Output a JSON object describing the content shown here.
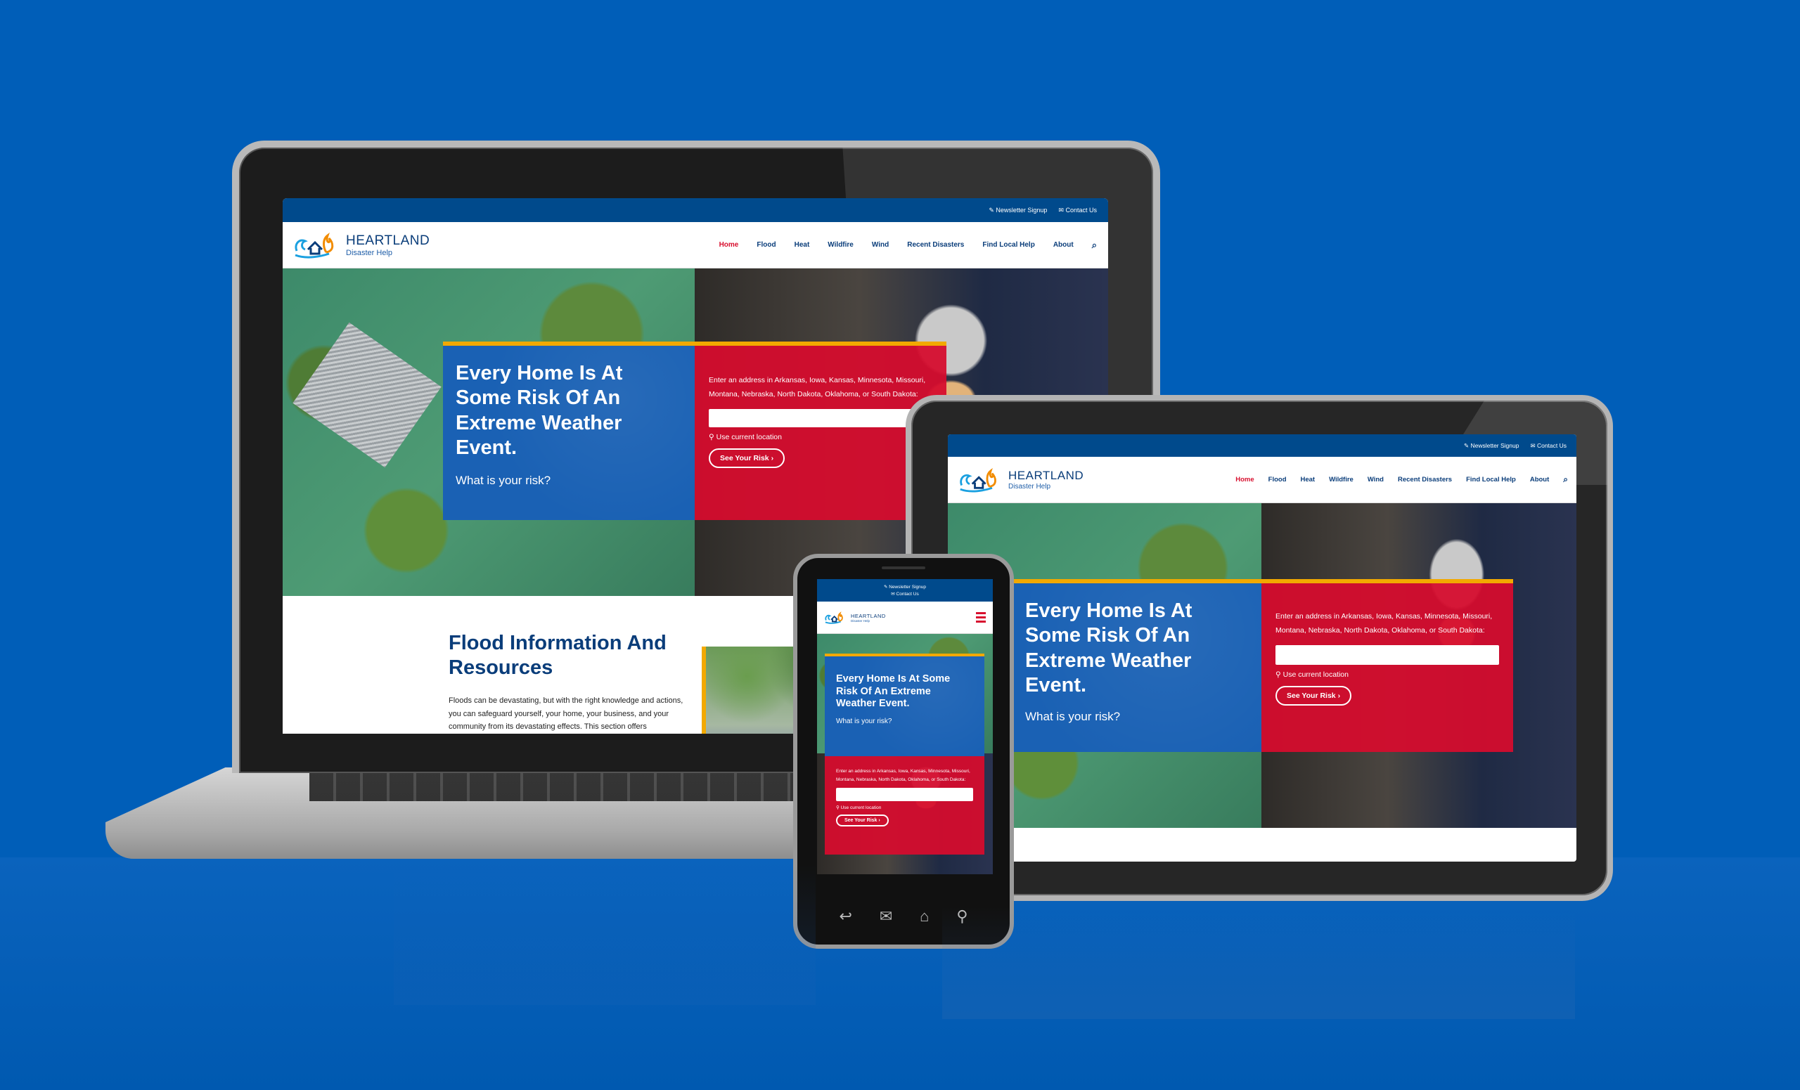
{
  "colors": {
    "background": "#005EB8",
    "topbar": "#004A8C",
    "navy_text": "#0a3d7a",
    "active_red": "#d8102f",
    "hero_blue": "#1a61b4",
    "hero_red": "#d60c2e",
    "accent_gold": "#f2a900"
  },
  "site": {
    "brand": "HEARTLAND",
    "tagline": "Disaster Help",
    "topbar": {
      "newsletter_icon": "pencil-icon",
      "newsletter": "Newsletter Signup",
      "contact_icon": "envelope-icon",
      "contact": "Contact Us"
    },
    "nav": [
      {
        "label": "Home",
        "active": true
      },
      {
        "label": "Flood",
        "active": false
      },
      {
        "label": "Heat",
        "active": false
      },
      {
        "label": "Wildfire",
        "active": false
      },
      {
        "label": "Wind",
        "active": false
      },
      {
        "label": "Recent Disasters",
        "active": false
      },
      {
        "label": "Find Local Help",
        "active": false
      },
      {
        "label": "About",
        "active": false
      }
    ],
    "search_icon": "search-icon",
    "menu_icon": "hamburger-menu-icon",
    "hero": {
      "headline": "Every Home Is At Some Risk Of An Extreme Weather Event.",
      "subhead": "What is your risk?",
      "prompt": "Enter an address in Arkansas, Iowa, Kansas, Minnesota, Missouri, Montana, Nebraska, North Dakota, Oklahoma, or South Dakota:",
      "address_value": "",
      "use_location_icon": "map-pin-icon",
      "use_location": "Use current location",
      "cta": "See Your Risk",
      "cta_icon": "›"
    },
    "flood": {
      "title": "Flood Information And Resources",
      "body": "Floods can be devastating, but with the right knowledge and actions, you can safeguard yourself, your home, your business, and your community from its devastating effects. This section offers"
    }
  },
  "phone_nav": {
    "back": "↩",
    "mail": "✉",
    "home": "⌂",
    "search": "⚲"
  }
}
